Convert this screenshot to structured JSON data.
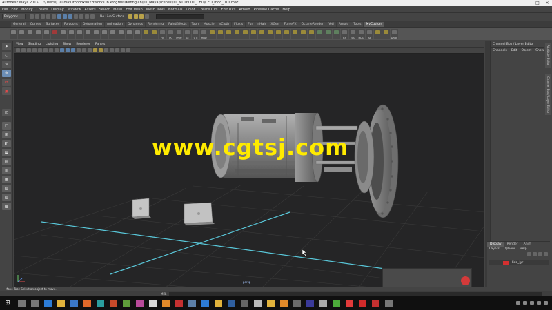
{
  "window": {
    "title": "Autodesk Maya 2015: C:\\Users\\Claudia\\Dropbox\\WZBWorks In Progress\\Kenngian\\01_Maya\\scenes\\01_MOD\\001_CEO\\CEO_mod_010.ma*",
    "controls": [
      "–",
      "□",
      "×"
    ]
  },
  "menubar": [
    "File",
    "Edit",
    "Modify",
    "Create",
    "Display",
    "Window",
    "Assets",
    "Select",
    "Mesh",
    "Edit Mesh",
    "Mesh Tools",
    "Normals",
    "Color",
    "Create UVs",
    "Edit UVs",
    "Arnold",
    "Pipeline Cache",
    "Help"
  ],
  "statusline": {
    "mode": "Polygons",
    "live_surface": "No Live Surface"
  },
  "shelf_tabs": [
    "General",
    "Curves",
    "Surfaces",
    "Polygons",
    "Deformation",
    "Animation",
    "Dynamics",
    "Rendering",
    "PaintEffects",
    "Toon",
    "Muscle",
    "nCloth",
    "Fluids",
    "Fur",
    "nHair",
    "XGen",
    "FumeFX",
    "OctaneRender",
    "Yeti",
    "Arnold",
    "Tools",
    "MyCustom"
  ],
  "active_shelf_tab": "MyCustom",
  "shelf_icons": [
    {
      "label": "",
      "color": "#7d7d7d"
    },
    {
      "label": "",
      "color": "#7d7d7d"
    },
    {
      "label": "",
      "color": "#7d7d7d"
    },
    {
      "label": "",
      "color": "#7d7d7d"
    },
    {
      "label": "",
      "color": "#7d7d7d"
    },
    {
      "label": "",
      "color": "#a03a3a"
    },
    {
      "label": "",
      "color": "#7d7d7d"
    },
    {
      "label": "",
      "color": "#7d7d7d"
    },
    {
      "label": "",
      "color": "#7d7d7d"
    },
    {
      "label": "",
      "color": "#7d7d7d"
    },
    {
      "label": "",
      "color": "#7d7d7d"
    },
    {
      "label": "",
      "color": "#7d7d7d"
    },
    {
      "label": "",
      "color": "#7d7d7d"
    },
    {
      "label": "",
      "color": "#7d7d7d"
    },
    {
      "label": "",
      "color": "#7d7d7d"
    },
    {
      "label": "",
      "color": "#7d7d7d"
    },
    {
      "label": "",
      "color": "#9a8a3a"
    },
    {
      "label": "",
      "color": "#9a8a3a"
    },
    {
      "label": "FB",
      "color": "#6d6d6d"
    },
    {
      "label": "PC",
      "color": "#6d6d6d"
    },
    {
      "label": "Pmrf",
      "color": "#6d6d6d"
    },
    {
      "label": "SE",
      "color": "#6d6d6d"
    },
    {
      "label": "UTI",
      "color": "#6d6d6d"
    },
    {
      "label": "MBD",
      "color": "#6d6d6d"
    },
    {
      "label": "",
      "color": "#9a8a3a"
    },
    {
      "label": "",
      "color": "#9a8a3a"
    },
    {
      "label": "",
      "color": "#9a8a3a"
    },
    {
      "label": "",
      "color": "#9a8a3a"
    },
    {
      "label": "",
      "color": "#9a8a3a"
    },
    {
      "label": "",
      "color": "#9a8a3a"
    },
    {
      "label": "",
      "color": "#9a8a3a"
    },
    {
      "label": "",
      "color": "#9a8a3a"
    },
    {
      "label": "",
      "color": "#9a8a3a"
    },
    {
      "label": "",
      "color": "#9a8a3a"
    },
    {
      "label": "",
      "color": "#9a8a3a"
    },
    {
      "label": "",
      "color": "#9a8a3a"
    },
    {
      "label": "",
      "color": "#9a8a3a"
    },
    {
      "label": "",
      "color": "#5e7f5e"
    },
    {
      "label": "",
      "color": "#5e7f5e"
    },
    {
      "label": "",
      "color": "#5e7f5e"
    },
    {
      "label": "RS",
      "color": "#6d6d6d"
    },
    {
      "label": "SS",
      "color": "#6d6d6d"
    },
    {
      "label": "HDO",
      "color": "#6d6d6d"
    },
    {
      "label": "AB",
      "color": "#6d6d6d"
    },
    {
      "label": "",
      "color": "#9a8a3a"
    },
    {
      "label": "",
      "color": "#9a8a3a"
    },
    {
      "label": "DRad",
      "color": "#6d6d6d"
    }
  ],
  "panel_menu": [
    "View",
    "Shading",
    "Lighting",
    "Show",
    "Renderer",
    "Panels"
  ],
  "viewport": {
    "camera": "persp",
    "watermark": "www.cgtsj.com"
  },
  "channel_box": {
    "header": "Channel Box / Layer Editor",
    "menus": [
      "Channels",
      "Edit",
      "Object",
      "Show"
    ]
  },
  "side_tabs": [
    "Attribute Editor",
    "Channel Box / Layer Editor"
  ],
  "layer_editor": {
    "tabs": [
      "Display",
      "Render",
      "Anim"
    ],
    "active_tab": "Display",
    "menus": [
      "Layers",
      "Options",
      "Help"
    ],
    "layers": [
      {
        "name": "Hide_lyr",
        "color": "#d43030"
      }
    ]
  },
  "helpline": "Move Tool: Select an object to move.",
  "mel_label": "MEL",
  "taskbar": {
    "icons": [
      {
        "name": "search",
        "color": "#777"
      },
      {
        "name": "task-view",
        "color": "#777"
      },
      {
        "name": "edge",
        "color": "#2d7cd6"
      },
      {
        "name": "explorer",
        "color": "#e2b33c"
      },
      {
        "name": "store",
        "color": "#3a78c9"
      },
      {
        "name": "firefox",
        "color": "#e0692a"
      },
      {
        "name": "maya",
        "color": "#2a9d9d"
      },
      {
        "name": "app",
        "color": "#c94a2a"
      },
      {
        "name": "app2",
        "color": "#5e9e3a"
      },
      {
        "name": "app3",
        "color": "#b84a9a"
      },
      {
        "name": "app4",
        "color": "#d9d9d9"
      },
      {
        "name": "app5",
        "color": "#e28a2a"
      },
      {
        "name": "app6",
        "color": "#c43030"
      },
      {
        "name": "app7",
        "color": "#5b7fa8"
      },
      {
        "name": "windows",
        "color": "#2d7cd6"
      },
      {
        "name": "folder",
        "color": "#e2b33c"
      },
      {
        "name": "photoshop",
        "color": "#2f5f9f"
      },
      {
        "name": "app8",
        "color": "#666"
      },
      {
        "name": "app9",
        "color": "#bbb"
      },
      {
        "name": "app10",
        "color": "#e2b33c"
      },
      {
        "name": "app11",
        "color": "#e28a2a"
      },
      {
        "name": "app12",
        "color": "#6a6a6a"
      },
      {
        "name": "app13",
        "color": "#3a3a9a"
      },
      {
        "name": "app14",
        "color": "#aaa"
      },
      {
        "name": "evernote",
        "color": "#4cab3a"
      },
      {
        "name": "app15",
        "color": "#e03a3a"
      },
      {
        "name": "app16",
        "color": "#d12a2a"
      },
      {
        "name": "app17",
        "color": "#c43030"
      },
      {
        "name": "app18",
        "color": "#777"
      }
    ]
  }
}
